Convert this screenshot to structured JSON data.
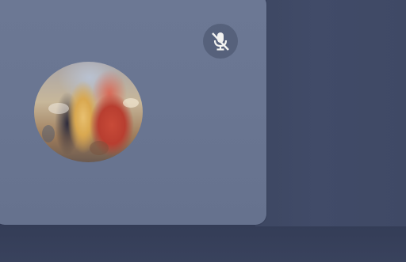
{
  "participant": {
    "mic_icon": "mic-muted-icon",
    "avatar_alt": ""
  },
  "colors": {
    "tile": "#6a7692",
    "background": "#3c4661",
    "mic_icon": "#f2f2f0"
  }
}
